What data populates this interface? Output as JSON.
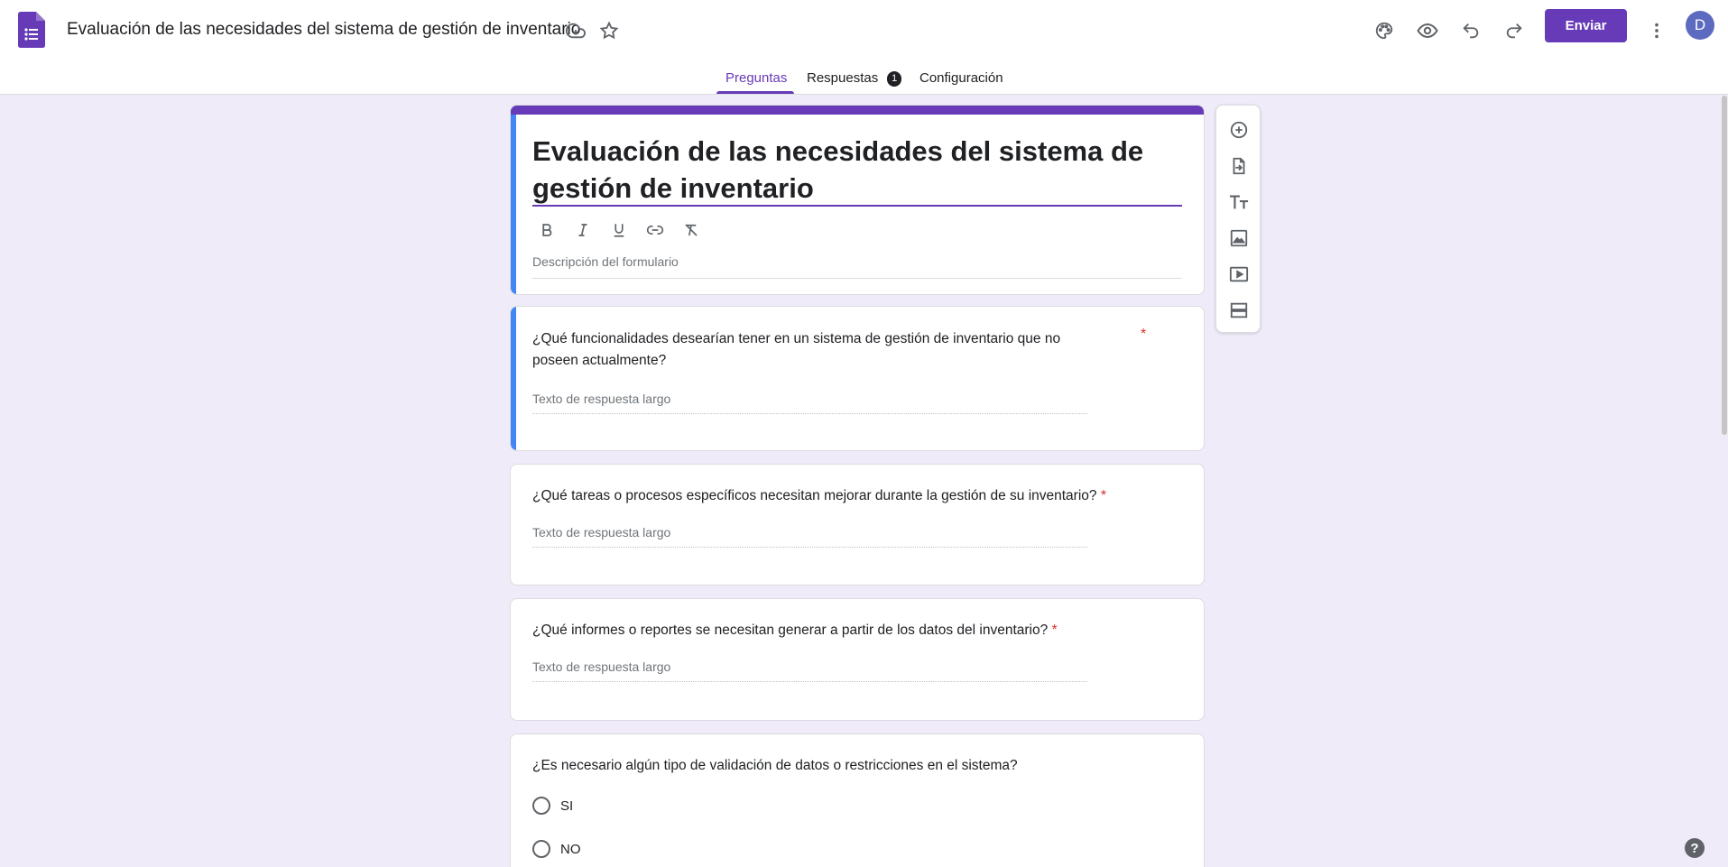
{
  "header": {
    "doc_title": "Evaluación de las necesidades del sistema de gestión de inventario",
    "send_label": "Enviar",
    "avatar_initial": "D",
    "icons": [
      "forms-logo-icon",
      "move-to-folder-icon",
      "star-icon",
      "palette-icon",
      "preview-eye-icon",
      "undo-icon",
      "redo-icon",
      "more-vert-icon"
    ]
  },
  "tabs": {
    "questions": "Preguntas",
    "responses": "Respuestas",
    "responses_count": "1",
    "settings": "Configuración"
  },
  "form": {
    "title": "Evaluación de las necesidades del sistema de gestión de inventario",
    "description_placeholder": "Descripción del formulario",
    "formatting": [
      "bold-icon",
      "italic-icon",
      "underline-icon",
      "link-icon",
      "clear-format-icon"
    ]
  },
  "questions": [
    {
      "text": "¿Qué funcionalidades desearían tener en un sistema de gestión de inventario que no poseen actualmente?",
      "required_mark": "*",
      "answer_placeholder": "Texto de respuesta largo"
    },
    {
      "text": "¿Qué tareas o procesos específicos necesitan mejorar  durante la gestión de su inventario?",
      "required_mark": "*",
      "answer_placeholder": "Texto de respuesta largo"
    },
    {
      "text": "¿Qué informes o reportes se necesitan generar a partir de los datos del inventario?",
      "required_mark": "*",
      "answer_placeholder": "Texto de respuesta largo"
    },
    {
      "text": "¿Es necesario algún tipo de validación de datos o restricciones en el sistema?",
      "options": [
        "SI",
        "NO"
      ]
    }
  ],
  "side_toolbar": [
    "add-question-icon",
    "import-questions-icon",
    "add-title-icon",
    "add-image-icon",
    "add-video-icon",
    "add-section-icon"
  ],
  "help_label": "?",
  "colors": {
    "accent": "#673ab7",
    "selected_bar": "#4285f4",
    "background": "#f0ebf8",
    "required": "#d93025"
  }
}
